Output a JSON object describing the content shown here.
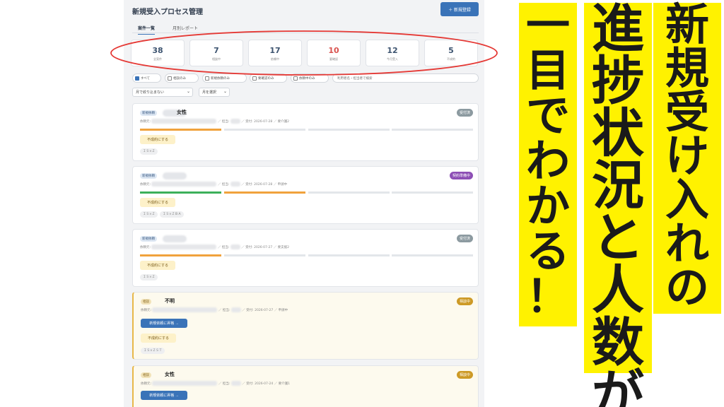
{
  "header": {
    "title": "新規受入プロセス管理",
    "add_button": "＋ 新規登録"
  },
  "tabs": [
    {
      "label": "案件一覧",
      "active": true
    },
    {
      "label": "月別レポート",
      "active": false
    }
  ],
  "stats": [
    {
      "value": "38",
      "label": "全案件",
      "color": "#3d5470"
    },
    {
      "value": "7",
      "label": "相談中",
      "color": "#3d5470"
    },
    {
      "value": "17",
      "label": "依頼中",
      "color": "#3d5470"
    },
    {
      "value": "10",
      "label": "要確認",
      "color": "#d9534f"
    },
    {
      "value": "12",
      "label": "今月受入",
      "color": "#3d5470"
    },
    {
      "value": "5",
      "label": "不成約",
      "color": "#3d5470"
    }
  ],
  "filters": {
    "chips": [
      "すべて",
      "相談のみ",
      "新規依頼のみ",
      "要確認のみ",
      "依頼中のみ"
    ],
    "search_placeholder": "利用者名・担当者で検索",
    "month_select": "月で絞り込まない",
    "month_picker": "月を選択"
  },
  "cards": [
    {
      "type": "新規依頼",
      "name": "女性",
      "status": "受付済",
      "status_color": "#8c9aa0",
      "meta_label": "依頼元:",
      "meta_tail": "／ 担当:",
      "meta_date": "／ 受付: 2026-07-28 ／ 要介護2",
      "progress": [
        "orange",
        "gray",
        "gray",
        "gray"
      ],
      "fail_button": "不成約にする",
      "tags": [
        "ＩＳ×Ｚ"
      ]
    },
    {
      "type": "新規依頼",
      "name": "",
      "status": "契約準備中",
      "status_color": "#8d4fb5",
      "meta_label": "依頼元:",
      "meta_tail": "／ 担当:",
      "meta_date": "／ 受付: 2026-07-28 ／ 申請中",
      "progress": [
        "green",
        "orange",
        "gray",
        "gray"
      ],
      "fail_button": "不成約にする",
      "tags": [
        "ＩＳ×Ｚ",
        "ＩＳ×ＺＢＡ"
      ]
    },
    {
      "type": "新規依頼",
      "name": "",
      "status": "受付済",
      "status_color": "#8c9aa0",
      "meta_label": "依頼元:",
      "meta_tail": "／ 担当:",
      "meta_date": "／ 受付: 2026-07-27 ／ 要支援2",
      "progress": [
        "orange",
        "gray",
        "gray",
        "gray"
      ],
      "fail_button": "不成約にする",
      "tags": [
        "ＩＳ×Ｚ"
      ]
    },
    {
      "type": "相談",
      "name": "不明",
      "status": "相談中",
      "status_color": "#cd9a26",
      "meta_label": "依頼元:",
      "meta_tail": "／ 担当:",
      "meta_date": "／ 受付: 2026-07-27 ／ 申請中",
      "promote_button": "新規依頼に昇格 →",
      "fail_button": "不成約にする",
      "tags": [
        "ＩＳ×ＺＳＴ"
      ]
    },
    {
      "type": "相談",
      "name": "女性",
      "status": "相談中",
      "status_color": "#cd9a26",
      "meta_label": "依頼元:",
      "meta_tail": "／ 担当:",
      "meta_date": "／ 受付: 2026-07-24 ／ 要介護1",
      "promote_button": "新規依頼に昇格 →"
    }
  ],
  "caption": {
    "line1": "新規受け入れの",
    "line2": "進捗状況と人数が",
    "line3": "一目でわかる！"
  },
  "highlight_color": "#fff200",
  "annotation_color": "#e53935"
}
